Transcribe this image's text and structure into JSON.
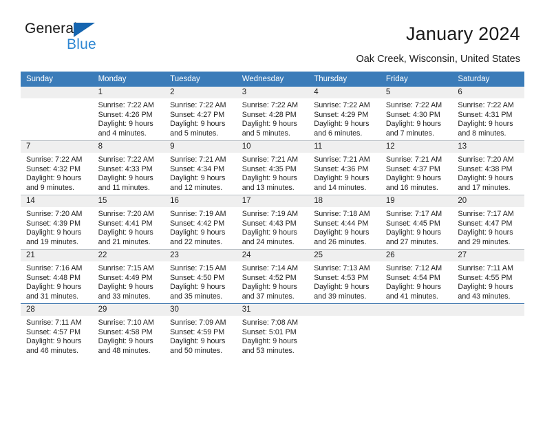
{
  "brand": {
    "name_part1": "General",
    "name_part2": "Blue",
    "triangle_icon": "blue-triangle-icon",
    "accent_color": "#2f87d2",
    "triangle_color": "#1565b0"
  },
  "header": {
    "title": "January 2024",
    "subtitle": "Oak Creek, Wisconsin, United States"
  },
  "calendar": {
    "header_bg_color": "#3b7cb9",
    "daynum_bg_color": "#efefef",
    "weekday_headers": [
      "Sunday",
      "Monday",
      "Tuesday",
      "Wednesday",
      "Thursday",
      "Friday",
      "Saturday"
    ],
    "weeks": [
      [
        {
          "day": "",
          "lines": []
        },
        {
          "day": "1",
          "lines": [
            "Sunrise: 7:22 AM",
            "Sunset: 4:26 PM",
            "Daylight: 9 hours",
            "and 4 minutes."
          ]
        },
        {
          "day": "2",
          "lines": [
            "Sunrise: 7:22 AM",
            "Sunset: 4:27 PM",
            "Daylight: 9 hours",
            "and 5 minutes."
          ]
        },
        {
          "day": "3",
          "lines": [
            "Sunrise: 7:22 AM",
            "Sunset: 4:28 PM",
            "Daylight: 9 hours",
            "and 5 minutes."
          ]
        },
        {
          "day": "4",
          "lines": [
            "Sunrise: 7:22 AM",
            "Sunset: 4:29 PM",
            "Daylight: 9 hours",
            "and 6 minutes."
          ]
        },
        {
          "day": "5",
          "lines": [
            "Sunrise: 7:22 AM",
            "Sunset: 4:30 PM",
            "Daylight: 9 hours",
            "and 7 minutes."
          ]
        },
        {
          "day": "6",
          "lines": [
            "Sunrise: 7:22 AM",
            "Sunset: 4:31 PM",
            "Daylight: 9 hours",
            "and 8 minutes."
          ]
        }
      ],
      [
        {
          "day": "7",
          "lines": [
            "Sunrise: 7:22 AM",
            "Sunset: 4:32 PM",
            "Daylight: 9 hours",
            "and 9 minutes."
          ]
        },
        {
          "day": "8",
          "lines": [
            "Sunrise: 7:22 AM",
            "Sunset: 4:33 PM",
            "Daylight: 9 hours",
            "and 11 minutes."
          ]
        },
        {
          "day": "9",
          "lines": [
            "Sunrise: 7:21 AM",
            "Sunset: 4:34 PM",
            "Daylight: 9 hours",
            "and 12 minutes."
          ]
        },
        {
          "day": "10",
          "lines": [
            "Sunrise: 7:21 AM",
            "Sunset: 4:35 PM",
            "Daylight: 9 hours",
            "and 13 minutes."
          ]
        },
        {
          "day": "11",
          "lines": [
            "Sunrise: 7:21 AM",
            "Sunset: 4:36 PM",
            "Daylight: 9 hours",
            "and 14 minutes."
          ]
        },
        {
          "day": "12",
          "lines": [
            "Sunrise: 7:21 AM",
            "Sunset: 4:37 PM",
            "Daylight: 9 hours",
            "and 16 minutes."
          ]
        },
        {
          "day": "13",
          "lines": [
            "Sunrise: 7:20 AM",
            "Sunset: 4:38 PM",
            "Daylight: 9 hours",
            "and 17 minutes."
          ]
        }
      ],
      [
        {
          "day": "14",
          "lines": [
            "Sunrise: 7:20 AM",
            "Sunset: 4:39 PM",
            "Daylight: 9 hours",
            "and 19 minutes."
          ]
        },
        {
          "day": "15",
          "lines": [
            "Sunrise: 7:20 AM",
            "Sunset: 4:41 PM",
            "Daylight: 9 hours",
            "and 21 minutes."
          ]
        },
        {
          "day": "16",
          "lines": [
            "Sunrise: 7:19 AM",
            "Sunset: 4:42 PM",
            "Daylight: 9 hours",
            "and 22 minutes."
          ]
        },
        {
          "day": "17",
          "lines": [
            "Sunrise: 7:19 AM",
            "Sunset: 4:43 PM",
            "Daylight: 9 hours",
            "and 24 minutes."
          ]
        },
        {
          "day": "18",
          "lines": [
            "Sunrise: 7:18 AM",
            "Sunset: 4:44 PM",
            "Daylight: 9 hours",
            "and 26 minutes."
          ]
        },
        {
          "day": "19",
          "lines": [
            "Sunrise: 7:17 AM",
            "Sunset: 4:45 PM",
            "Daylight: 9 hours",
            "and 27 minutes."
          ]
        },
        {
          "day": "20",
          "lines": [
            "Sunrise: 7:17 AM",
            "Sunset: 4:47 PM",
            "Daylight: 9 hours",
            "and 29 minutes."
          ]
        }
      ],
      [
        {
          "day": "21",
          "lines": [
            "Sunrise: 7:16 AM",
            "Sunset: 4:48 PM",
            "Daylight: 9 hours",
            "and 31 minutes."
          ]
        },
        {
          "day": "22",
          "lines": [
            "Sunrise: 7:15 AM",
            "Sunset: 4:49 PM",
            "Daylight: 9 hours",
            "and 33 minutes."
          ]
        },
        {
          "day": "23",
          "lines": [
            "Sunrise: 7:15 AM",
            "Sunset: 4:50 PM",
            "Daylight: 9 hours",
            "and 35 minutes."
          ]
        },
        {
          "day": "24",
          "lines": [
            "Sunrise: 7:14 AM",
            "Sunset: 4:52 PM",
            "Daylight: 9 hours",
            "and 37 minutes."
          ]
        },
        {
          "day": "25",
          "lines": [
            "Sunrise: 7:13 AM",
            "Sunset: 4:53 PM",
            "Daylight: 9 hours",
            "and 39 minutes."
          ]
        },
        {
          "day": "26",
          "lines": [
            "Sunrise: 7:12 AM",
            "Sunset: 4:54 PM",
            "Daylight: 9 hours",
            "and 41 minutes."
          ]
        },
        {
          "day": "27",
          "lines": [
            "Sunrise: 7:11 AM",
            "Sunset: 4:55 PM",
            "Daylight: 9 hours",
            "and 43 minutes."
          ]
        }
      ],
      [
        {
          "day": "28",
          "lines": [
            "Sunrise: 7:11 AM",
            "Sunset: 4:57 PM",
            "Daylight: 9 hours",
            "and 46 minutes."
          ]
        },
        {
          "day": "29",
          "lines": [
            "Sunrise: 7:10 AM",
            "Sunset: 4:58 PM",
            "Daylight: 9 hours",
            "and 48 minutes."
          ]
        },
        {
          "day": "30",
          "lines": [
            "Sunrise: 7:09 AM",
            "Sunset: 4:59 PM",
            "Daylight: 9 hours",
            "and 50 minutes."
          ]
        },
        {
          "day": "31",
          "lines": [
            "Sunrise: 7:08 AM",
            "Sunset: 5:01 PM",
            "Daylight: 9 hours",
            "and 53 minutes."
          ]
        },
        {
          "day": "",
          "lines": []
        },
        {
          "day": "",
          "lines": []
        },
        {
          "day": "",
          "lines": []
        }
      ]
    ]
  }
}
